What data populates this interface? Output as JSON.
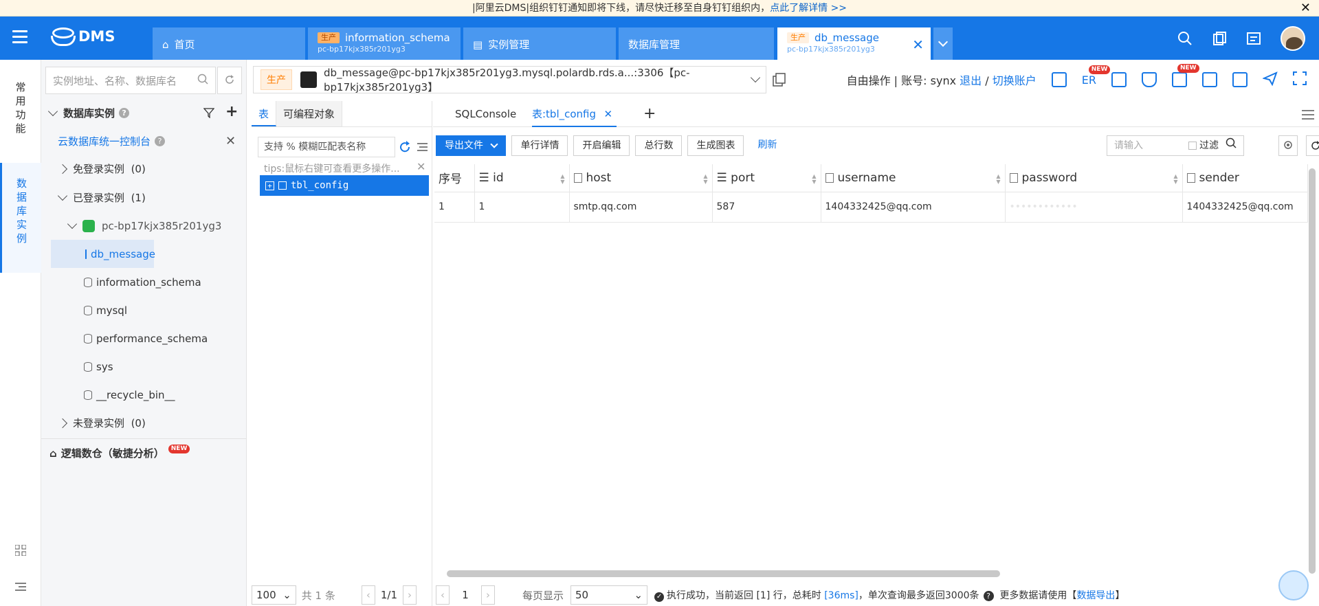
{
  "notice": {
    "text": "|阿里云DMS|组织钉钉通知即将下线，请尽快迁移至自身钉钉组织内，",
    "link": "点此了解详情 >>"
  },
  "header": {
    "app_name": "DMS",
    "tabs": [
      {
        "label": "首页",
        "icon": "home-icon"
      },
      {
        "tag": "生产",
        "label": "information_schema",
        "sub": "pc-bp17kjx385r201yg3"
      },
      {
        "label": "实例管理",
        "icon": "instance-icon"
      },
      {
        "label": "数据库管理"
      },
      {
        "tag": "生产",
        "label": "db_message",
        "sub": "pc-bp17kjx385r201yg3"
      }
    ]
  },
  "rail": {
    "common": "常用功能",
    "db_instance": "数据库实例"
  },
  "sidebar": {
    "search_placeholder": "实例地址、名称、数据库名",
    "section_title": "数据库实例",
    "console_link": "云数据库统一控制台",
    "groups": {
      "free_login": "免登录实例",
      "free_login_count": "(0)",
      "logged_in": "已登录实例",
      "logged_in_count": "(1)",
      "not_logged_in": "未登录实例",
      "not_logged_in_count": "(0)"
    },
    "instance": "pc-bp17kjx385r201yg3",
    "databases": [
      "db_message",
      "information_schema",
      "mysql",
      "performance_schema",
      "sys",
      "__recycle_bin__"
    ],
    "logic_db": "逻辑数仓（敏捷分析）",
    "new_badge": "NEW"
  },
  "instbar": {
    "tag": "生产",
    "text": "db_message@pc-bp17kjx385r201yg3.mysql.polardb.rds.a...:3306【pc-bp17kjx385r201yg3】",
    "mode": "自由操作 | 账号: synx",
    "logout": "退出",
    "sep": "/",
    "switch": "切换账户",
    "er": "ER"
  },
  "objpanel": {
    "tab_table": "表",
    "tab_programmable": "可编程对象",
    "search_placeholder": "支持 % 模糊匹配表名称",
    "tips": "tips:鼠标右键可查看更多操作...",
    "table": "tbl_config"
  },
  "main": {
    "tab_console": "SQLConsole",
    "tab_table": "表:tbl_config",
    "toolbar": {
      "export": "导出文件",
      "row_detail": "单行详情",
      "enable_edit": "开启编辑",
      "total_rows": "总行数",
      "gen_chart": "生成图表",
      "refresh": "刷新"
    },
    "filter_placeholder": "请输入",
    "filter_label": "过滤",
    "columns": [
      "序号",
      "id",
      "host",
      "port",
      "username",
      "password",
      "sender"
    ],
    "rows": [
      [
        "1",
        "1",
        "smtp.qq.com",
        "587",
        "1404332425@qq.com",
        "••••••••••••",
        "1404332425@qq.com"
      ]
    ]
  },
  "footer": {
    "page_size": "100",
    "total": "共 1 条",
    "page": "1/1",
    "current_page": "1",
    "per_page_label": "每页显示",
    "per_page_value": "50",
    "status_prefix": "执行成功，当前返回",
    "returned": "[1]",
    "status_mid": "行，总耗时",
    "elapsed": "[36ms]",
    "status_suffix": "，单次查询最多返回3000条",
    "more_text": "更多数据请使用【",
    "export_link": "数据导出",
    "more_close": "】"
  }
}
